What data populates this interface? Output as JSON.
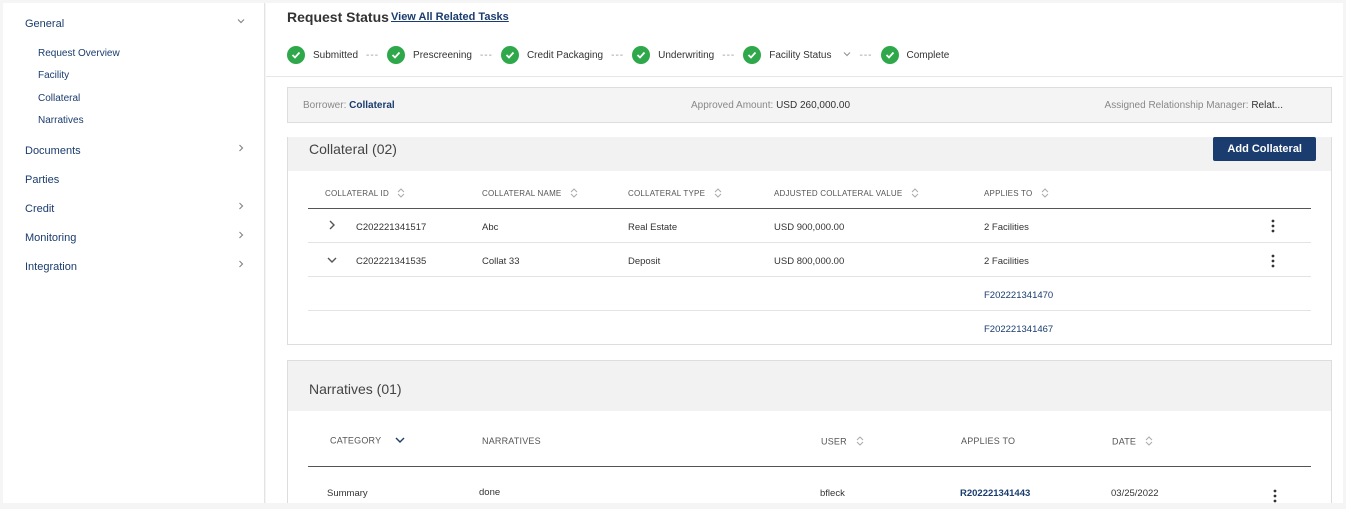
{
  "sidebar": {
    "items": [
      {
        "label": "General",
        "expanded": true,
        "sub": [
          "Request Overview",
          "Facility",
          "Collateral",
          "Narratives"
        ]
      },
      {
        "label": "Documents"
      },
      {
        "label": "Parties"
      },
      {
        "label": "Credit"
      },
      {
        "label": "Monitoring"
      },
      {
        "label": "Integration"
      }
    ]
  },
  "header": {
    "title": "Request Status",
    "link": "View All Related Tasks",
    "steps": [
      "Submitted",
      "Prescreening",
      "Credit Packaging",
      "Underwriting",
      "Facility Status",
      "Complete"
    ],
    "step_separator": "---"
  },
  "borrower": {
    "borrower_label": "Borrower:",
    "borrower_value": "Collateral",
    "amount_label": "Approved Amount:",
    "amount_value": "USD 260,000.00",
    "manager_label": "Assigned Relationship Manager:",
    "manager_value": "Relat..."
  },
  "collateral": {
    "title": "Collateral (02)",
    "add_button": "Add Collateral",
    "columns": [
      "COLLATERAL ID",
      "COLLATERAL NAME",
      "COLLATERAL TYPE",
      "ADJUSTED COLLATERAL VALUE",
      "APPLIES TO"
    ],
    "rows": [
      {
        "id": "C202221341517",
        "name": "Abc",
        "type": "Real Estate",
        "value": "USD 900,000.00",
        "applies": "2 Facilities"
      },
      {
        "id": "C202221341535",
        "name": "Collat 33",
        "type": "Deposit",
        "value": "USD 800,000.00",
        "applies": "2 Facilities"
      }
    ],
    "expanded_links": [
      "F202221341470",
      "F202221341467"
    ]
  },
  "narratives": {
    "title": "Narratives (01)",
    "columns": [
      "CATEGORY",
      "NARRATIVES",
      "USER",
      "APPLIES TO",
      "DATE"
    ],
    "rows": [
      {
        "category": "Summary",
        "narrative": "done",
        "user": "bfleck",
        "applies": "R202221341443",
        "date": "03/25/2022"
      }
    ]
  },
  "colors": {
    "accent": "#1a3c6e",
    "success": "#2ea84a"
  },
  "icons": {
    "check": "check-circle-icon",
    "chevron": "chevron-icon",
    "sort": "sort-icon",
    "kebab": "kebab-menu-icon"
  }
}
